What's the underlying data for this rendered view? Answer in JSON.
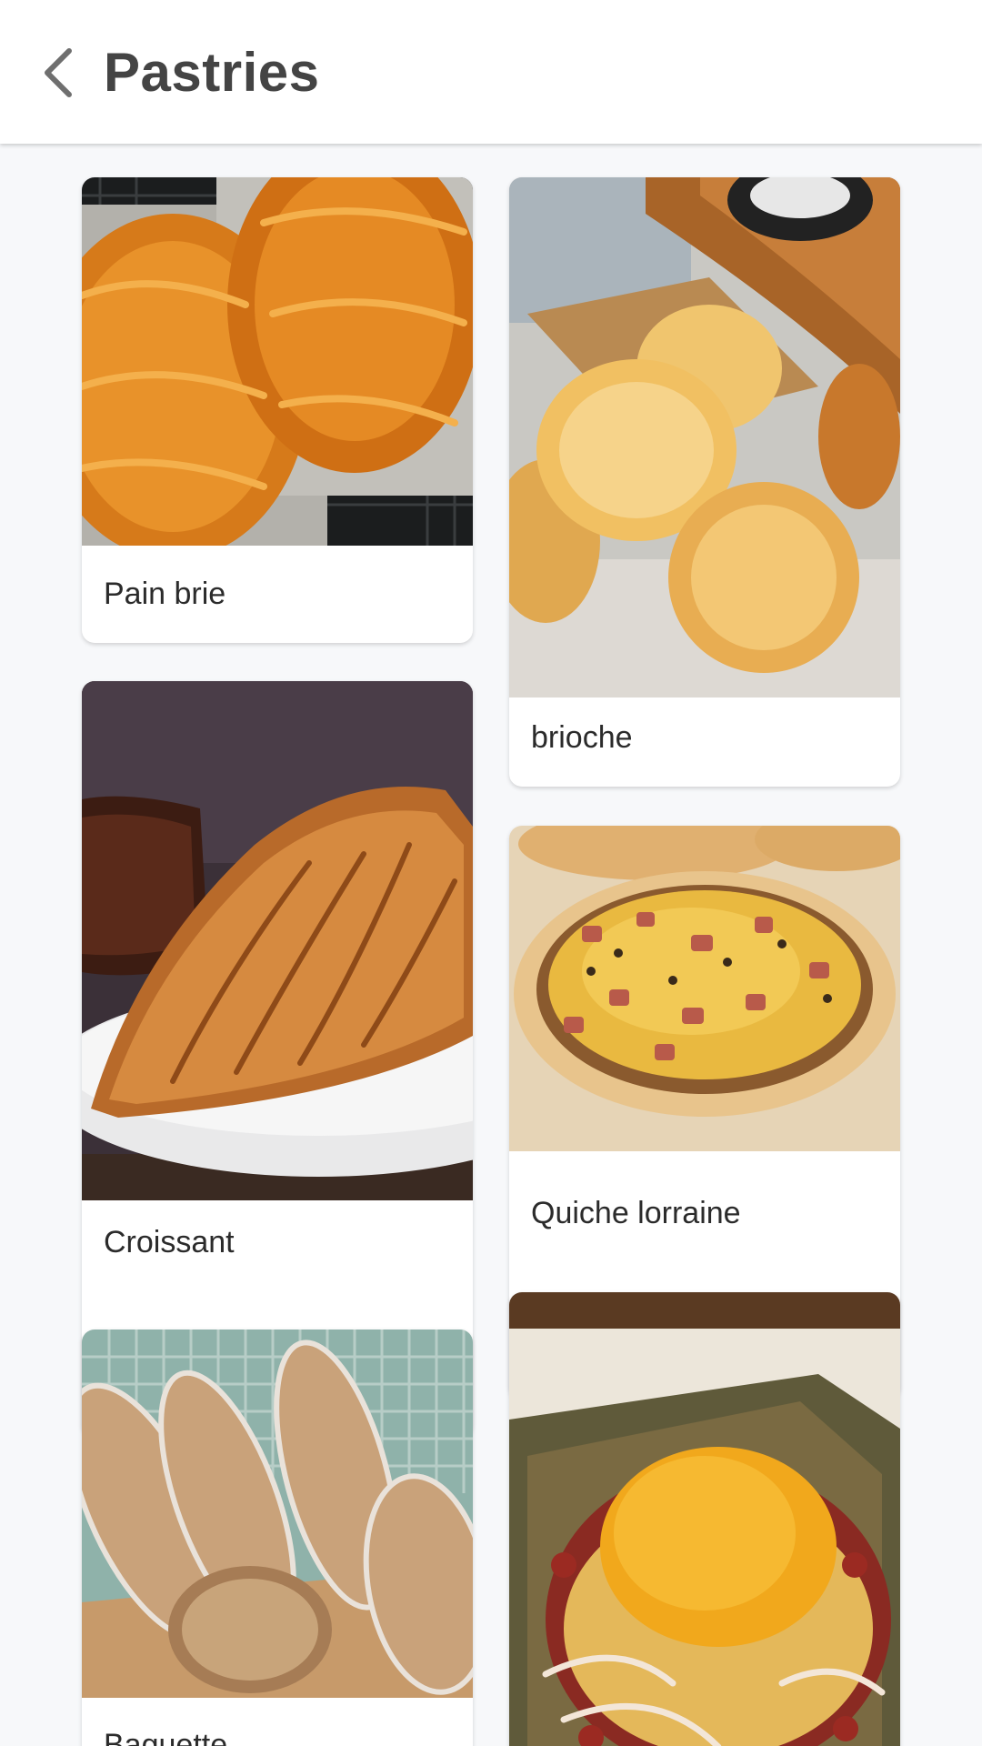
{
  "header": {
    "title": "Pastries",
    "back_icon": "chevron-left-icon"
  },
  "colors": {
    "background": "#f7f8fa",
    "card": "#ffffff",
    "title_text": "#444444",
    "label_text": "#2b2b2b"
  },
  "pastries": [
    {
      "label": "Pain brie",
      "image": "braided-bread-loaves-in-tins"
    },
    {
      "label": "brioche",
      "image": "brioche-rolls-on-cloth"
    },
    {
      "label": "Croissant",
      "image": "croissant-on-white-plate"
    },
    {
      "label": "Quiche lorraine",
      "image": "quiche-tartlets"
    },
    {
      "label": "Baguette",
      "image": "baguettes-in-crate"
    },
    {
      "label": "",
      "image": "galette-with-egg"
    }
  ]
}
